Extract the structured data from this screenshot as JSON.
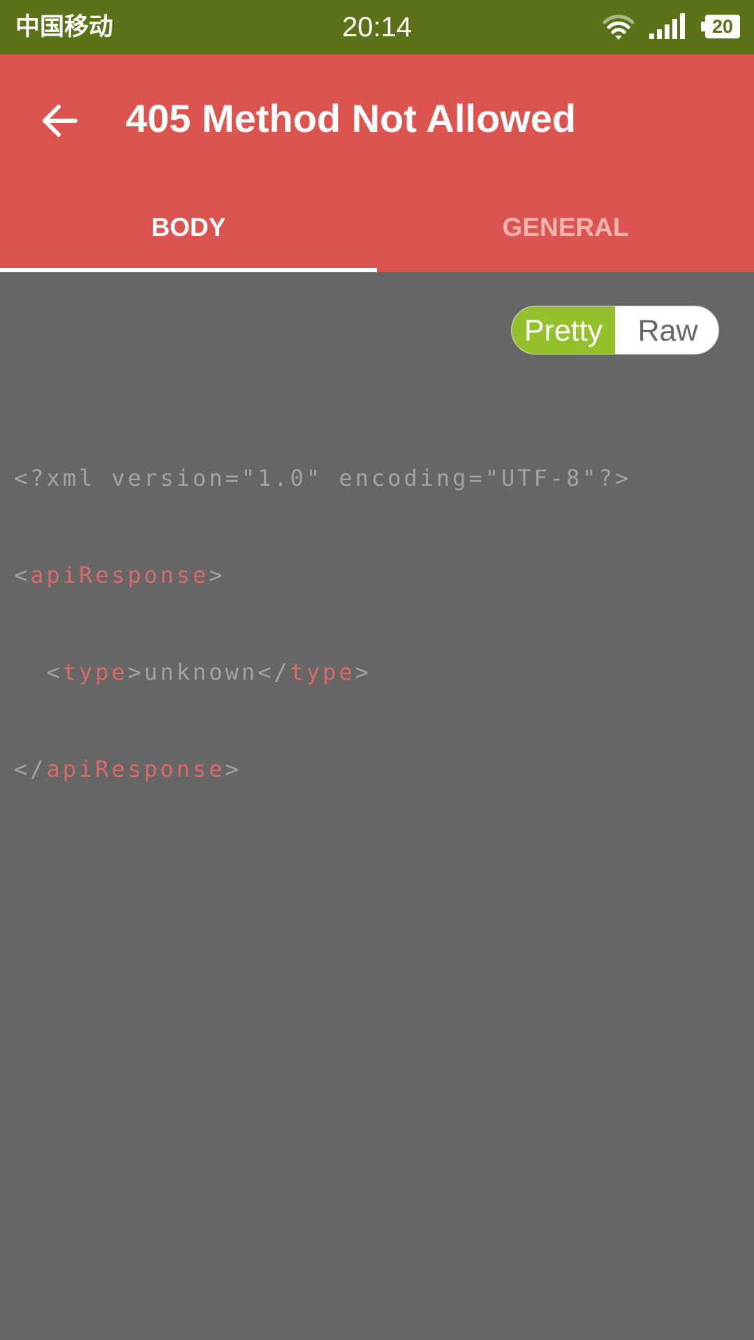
{
  "status_bar": {
    "carrier": "中国移动",
    "time": "20:14",
    "battery": "20",
    "icons": [
      "wifi-icon",
      "signal-icon",
      "battery-icon"
    ]
  },
  "header": {
    "title": "405 Method Not Allowed",
    "back_icon": "arrow-left-icon",
    "color": "#db5450"
  },
  "tabs": [
    {
      "label": "BODY",
      "active": true
    },
    {
      "label": "GENERAL",
      "active": false
    }
  ],
  "view_toggle": {
    "pretty_label": "Pretty",
    "raw_label": "Raw",
    "selected": "Pretty",
    "accent": "#94c02b"
  },
  "body": {
    "declaration": "<?xml version=\"1.0\" encoding=\"UTF-8\"?>",
    "root_tag": "apiResponse",
    "child_tag": "type",
    "child_value": "unknown"
  }
}
